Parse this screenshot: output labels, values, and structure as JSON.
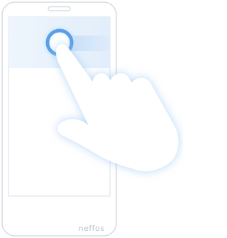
{
  "device": {
    "brand": "neffos"
  },
  "illustration": {
    "gesture": "tap-and-swipe",
    "icons": [
      "speaker-slot-icon",
      "touch-point-icon",
      "hand-pointer-icon"
    ],
    "colors": {
      "outline": "#d6dde2",
      "screen": "#ffffff",
      "highlight_band": "#e7f1fb",
      "touch_ring": "#5aa0e8",
      "glow": "#9cc8f5",
      "hand": "#ffffff",
      "brand_text": "#b9c2c8"
    }
  }
}
